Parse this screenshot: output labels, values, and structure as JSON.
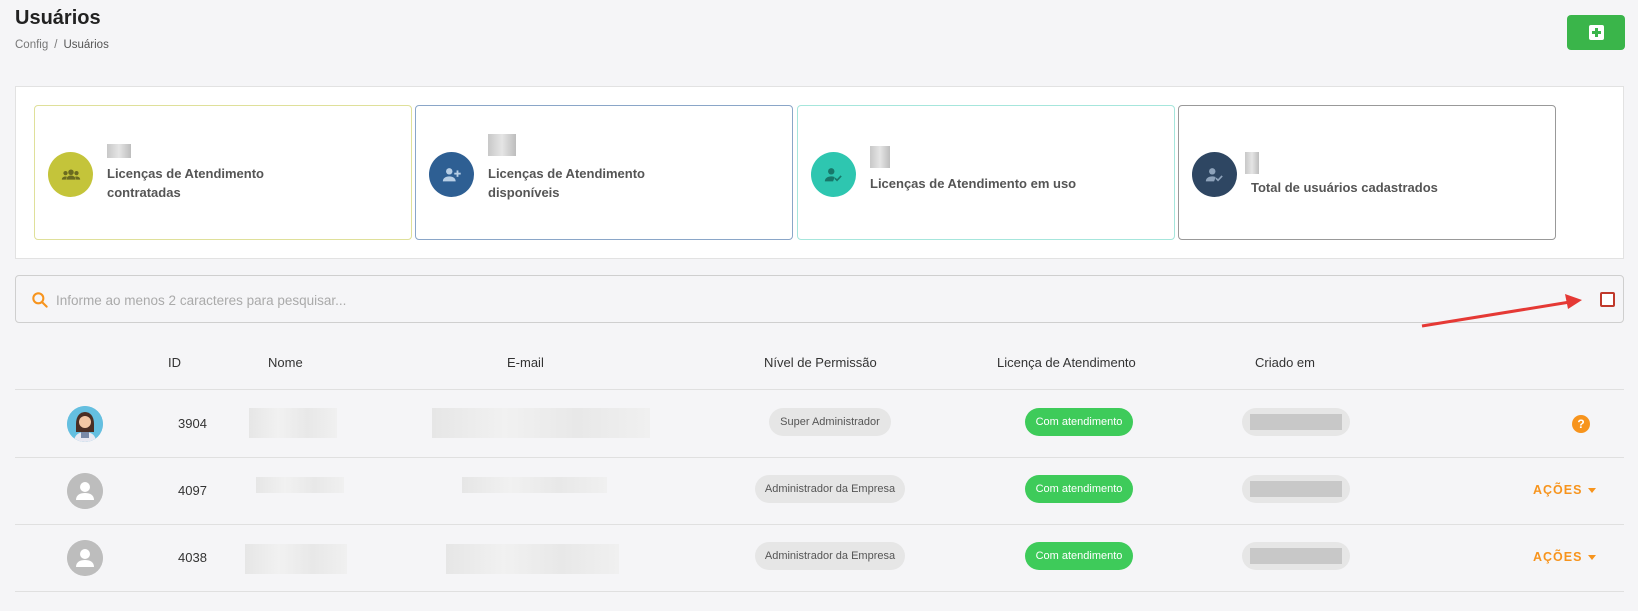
{
  "header": {
    "title": "Usuários",
    "breadcrumb": [
      "Config",
      "/",
      "Usuários"
    ],
    "add_icon": "plus-square-icon"
  },
  "stats": [
    {
      "label_line1": "Licenças de Atendimento",
      "label_line2": "contratadas",
      "color": "#c4c43a",
      "icon": "users-group-icon"
    },
    {
      "label_line1": "Licenças de Atendimento",
      "label_line2": "disponíveis",
      "color": "#2e5f93",
      "icon": "user-plus-icon"
    },
    {
      "label_line1": "Licenças de Atendimento em uso",
      "label_line2": "",
      "color": "#2ec6b0",
      "icon": "user-check-icon"
    },
    {
      "label_line1": "Total de usuários cadastrados",
      "label_line2": "",
      "color": "#2e4662",
      "icon": "user-check-icon"
    }
  ],
  "search": {
    "placeholder": "Informe ao menos 2 caracteres para pesquisar...",
    "value": ""
  },
  "table": {
    "columns": [
      "ID",
      "Nome",
      "E-mail",
      "Nível de Permissão",
      "Licença de Atendimento",
      "Criado em"
    ],
    "rows": [
      {
        "id": "3904",
        "permission": "Super Administrador",
        "license": "Com atendimento",
        "action": "help-icon"
      },
      {
        "id": "4097",
        "permission": "Administrador da Empresa",
        "license": "Com atendimento",
        "action": "AÇÕES"
      },
      {
        "id": "4038",
        "permission": "Administrador da Empresa",
        "license": "Com atendimento",
        "action": "AÇÕES"
      }
    ],
    "help_symbol": "?"
  }
}
